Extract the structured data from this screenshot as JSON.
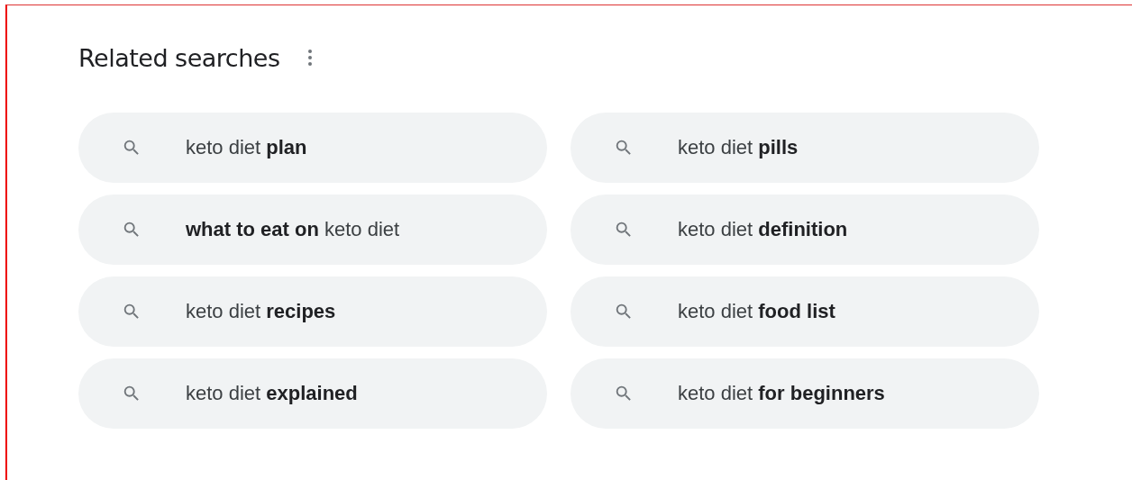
{
  "heading": "Related searches",
  "searches": [
    {
      "text": "keto diet **plan**"
    },
    {
      "text": "keto diet **pills**"
    },
    {
      "text": "**what to eat on** keto diet"
    },
    {
      "text": "keto diet **definition**"
    },
    {
      "text": "keto diet **recipes**"
    },
    {
      "text": "keto diet **food list**"
    },
    {
      "text": "keto diet **explained**"
    },
    {
      "text": "keto diet **for beginners**"
    }
  ]
}
